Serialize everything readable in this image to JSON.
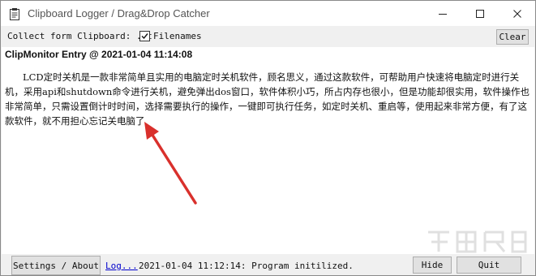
{
  "window": {
    "title": "Clipboard Logger / Drag&Drop Catcher",
    "controls": {
      "minimize": "—",
      "maximize": "☐",
      "close": "✕"
    }
  },
  "toolbar": {
    "collect_label": "Collect form Clipboard: .xt",
    "filenames_checked": true,
    "filenames_label": "Filenames",
    "clear_label": "Clear"
  },
  "entry": {
    "header": "ClipMonitor Entry @ 2021-01-04 11:14:08",
    "body": "LCD定时关机是一款非常简单且实用的电脑定时关机软件，顾名思义，通过这款软件，可帮助用户快速将电脑定时进行关机，采用api和shutdown命令进行关机，避免弹出dos窗口，软件体积小巧，所占内存也很小，但是功能却很实用，软件操作也非常简单，只需设置倒计时时间，选择需要执行的操作，一键即可执行任务，如定时关机、重启等，使用起来非常方便，有了这款软件，就不用担心忘记关电脑了"
  },
  "annotation": {
    "arrow_color": "#d9302c"
  },
  "bottom": {
    "settings_label": "Settings / About",
    "log_link": "Log...",
    "status": "2021-01-04 11:12:14: Program initilized.",
    "hide_label": "Hide",
    "quit_label": "Quit"
  }
}
